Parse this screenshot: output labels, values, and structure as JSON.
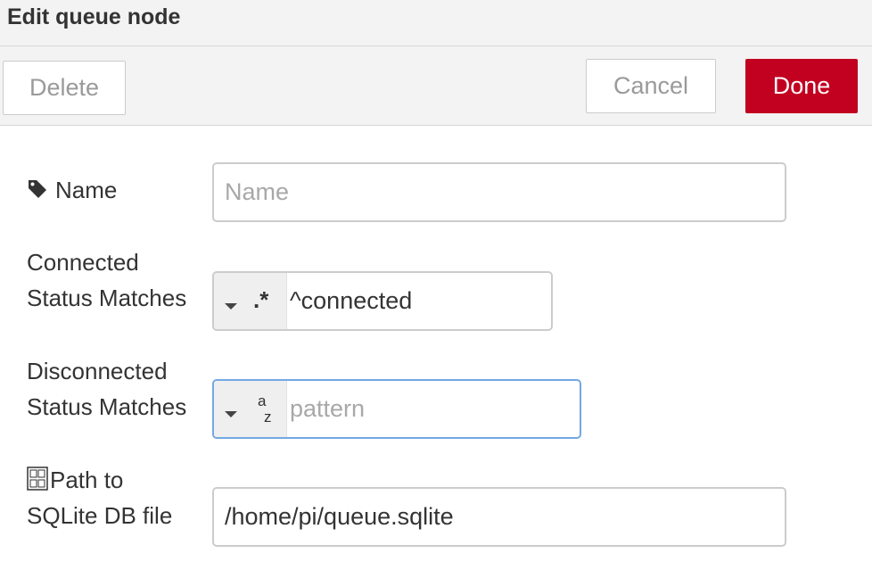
{
  "dialog": {
    "title": "Edit queue node"
  },
  "toolbar": {
    "delete_label": "Delete",
    "cancel_label": "Cancel",
    "done_label": "Done"
  },
  "colors": {
    "done_button": "#c20020",
    "focus_border": "#73a8e4"
  },
  "form": {
    "name": {
      "label": "Name",
      "icon": "tag-icon",
      "value": "",
      "placeholder": "Name"
    },
    "connected": {
      "label_line1": "Connected",
      "label_line2": "Status Matches",
      "type_icon": "regex-icon",
      "type_symbol": ".*",
      "value": "^connected",
      "placeholder": ""
    },
    "disconnected": {
      "label_line1": "Disconnected",
      "label_line2": "Status Matches",
      "type_icon": "string-az-icon",
      "value": "",
      "placeholder": "pattern"
    },
    "path": {
      "label_line1": "Path to",
      "label_line2": "SQLite DB file",
      "icon": "file-icon",
      "value": "/home/pi/queue.sqlite",
      "placeholder": ""
    }
  }
}
